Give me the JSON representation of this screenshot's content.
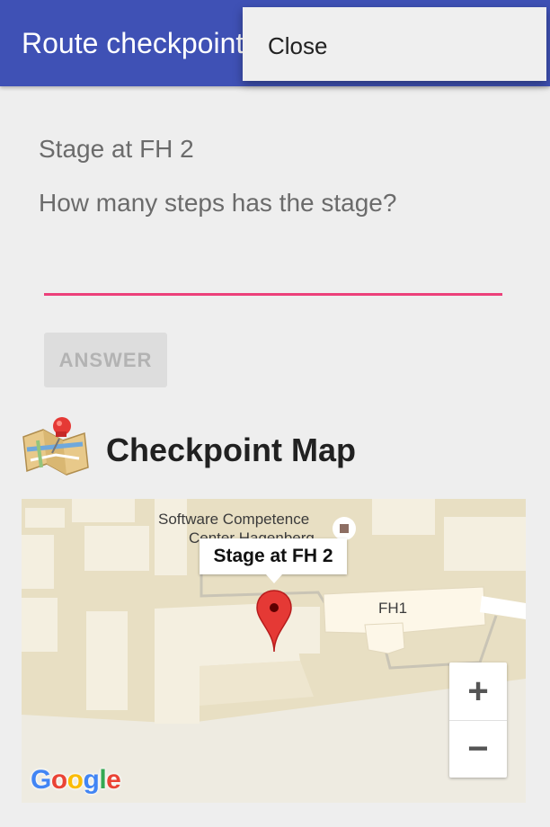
{
  "app_bar": {
    "title": "Route checkpoint",
    "color": "#3f51b5"
  },
  "overflow_menu": {
    "items": [
      {
        "label": "Close"
      }
    ]
  },
  "checkpoint": {
    "title": "Stage at FH 2",
    "question": "How many steps has the stage?"
  },
  "answer": {
    "value": "",
    "accent_color": "#ec407a",
    "button_label": "ANSWER",
    "button_enabled": false
  },
  "map_section": {
    "title": "Checkpoint Map",
    "icon": "folded-map-with-pin-icon",
    "map": {
      "labels": {
        "poi_line1": "Software Competence",
        "poi_line2": "Center Hagenberg",
        "building": "FH1"
      },
      "marker_title": "Stage at FH 2",
      "zoom_in": "+",
      "zoom_out": "−",
      "logo_letters": [
        {
          "char": "G",
          "color": "#4285f4"
        },
        {
          "char": "o",
          "color": "#ea4335"
        },
        {
          "char": "o",
          "color": "#fbbc05"
        },
        {
          "char": "g",
          "color": "#4285f4"
        },
        {
          "char": "l",
          "color": "#34a853"
        },
        {
          "char": "e",
          "color": "#ea4335"
        }
      ]
    }
  }
}
